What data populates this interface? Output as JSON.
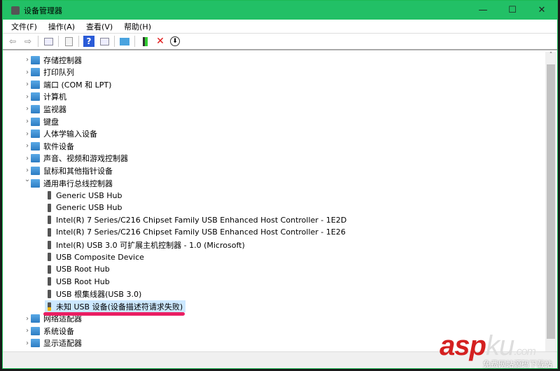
{
  "window": {
    "title": "设备管理器",
    "min": "—",
    "max": "☐",
    "close": "✕"
  },
  "menu": [
    "文件(F)",
    "操作(A)",
    "查看(V)",
    "帮助(H)"
  ],
  "toolbar": {
    "back": "⇦",
    "forward": "⇨",
    "help": "?",
    "remove": "✕",
    "download": "⬇"
  },
  "tree": [
    {
      "label": "存储控制器",
      "level": 0,
      "exp": "›"
    },
    {
      "label": "打印队列",
      "level": 0,
      "exp": "›"
    },
    {
      "label": "端口 (COM 和 LPT)",
      "level": 0,
      "exp": "›"
    },
    {
      "label": "计算机",
      "level": 0,
      "exp": "›"
    },
    {
      "label": "监视器",
      "level": 0,
      "exp": "›"
    },
    {
      "label": "键盘",
      "level": 0,
      "exp": "›"
    },
    {
      "label": "人体学输入设备",
      "level": 0,
      "exp": "›"
    },
    {
      "label": "软件设备",
      "level": 0,
      "exp": "›"
    },
    {
      "label": "声音、视频和游戏控制器",
      "level": 0,
      "exp": "›"
    },
    {
      "label": "鼠标和其他指针设备",
      "level": 0,
      "exp": "›"
    },
    {
      "label": "通用串行总线控制器",
      "level": 0,
      "exp": "⌄"
    },
    {
      "label": "Generic USB Hub",
      "level": 1
    },
    {
      "label": "Generic USB Hub",
      "level": 1
    },
    {
      "label": "Intel(R) 7 Series/C216 Chipset Family USB Enhanced Host Controller - 1E2D",
      "level": 1
    },
    {
      "label": "Intel(R) 7 Series/C216 Chipset Family USB Enhanced Host Controller - 1E26",
      "level": 1
    },
    {
      "label": "Intel(R) USB 3.0 可扩展主机控制器 - 1.0 (Microsoft)",
      "level": 1
    },
    {
      "label": "USB Composite Device",
      "level": 1
    },
    {
      "label": "USB Root Hub",
      "level": 1
    },
    {
      "label": "USB Root Hub",
      "level": 1
    },
    {
      "label": "USB 根集线器(USB 3.0)",
      "level": 1
    },
    {
      "label": "未知 USB 设备(设备描述符请求失败)",
      "level": 1,
      "warning": true,
      "selected": true
    },
    {
      "label": "网络适配器",
      "level": 0,
      "exp": "›"
    },
    {
      "label": "系统设备",
      "level": 0,
      "exp": "›"
    },
    {
      "label": "显示适配器",
      "level": 0,
      "exp": "›"
    }
  ],
  "watermark": {
    "brand": "asp",
    "brand2": "ku",
    "tld": ".com",
    "slogan": "免费网站源码下载站"
  },
  "colors": {
    "titlebar": "#22c066",
    "highlight": "#ea1e63",
    "selection": "#cce8ff"
  }
}
